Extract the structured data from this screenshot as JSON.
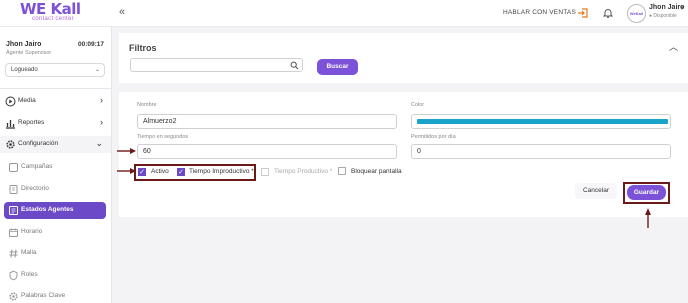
{
  "header": {
    "logo_main": "WE Kall",
    "logo_sub": "contact center",
    "collapse_glyph": "«",
    "hablar_label": "HABLAR CON VENTAS",
    "user_name": "Jhon Jairo",
    "user_status": "● Disponible",
    "avatar_text": "WeKall"
  },
  "agent": {
    "name": "Jhon Jairo",
    "time": "00:09:17",
    "role": "Agente Supervisor",
    "status_value": "Logueado"
  },
  "sidebar": {
    "items": [
      {
        "label": "Media",
        "icon": "play-circle-icon"
      },
      {
        "label": "Reportes",
        "icon": "chart-icon"
      },
      {
        "label": "Configuración",
        "icon": "gear-icon"
      },
      {
        "label": "Campañas",
        "icon": "campaign-icon"
      },
      {
        "label": "Directorio",
        "icon": "directory-icon"
      },
      {
        "label": "Estados Agentes",
        "icon": "agent-status-icon"
      },
      {
        "label": "Horario",
        "icon": "calendar-icon"
      },
      {
        "label": "Malla",
        "icon": "hash-icon"
      },
      {
        "label": "Roles",
        "icon": "shield-icon"
      },
      {
        "label": "Palabras Clave",
        "icon": "gear-icon"
      }
    ]
  },
  "filters": {
    "title": "Filtros",
    "search_value": "",
    "search_button": "Buscar"
  },
  "form": {
    "nombre_label": "Nombre",
    "nombre_value": "Almuerzo2",
    "color_label": "Color",
    "color_value": "#1aa3c8",
    "tiempo_label": "Tiempo en segundos",
    "tiempo_value": "60",
    "permitidos_label": "Permitidos por día",
    "permitidos_value": "0",
    "checkboxes": [
      {
        "label": "Activo",
        "checked": true
      },
      {
        "label": "Tiempo Improductivo *",
        "checked": true
      },
      {
        "label": "Tiempo Productivo *",
        "checked": false
      },
      {
        "label": "Bloquear pantalla",
        "checked": false
      }
    ],
    "cancel_label": "Cancelar",
    "save_label": "Guardar"
  },
  "colors": {
    "accent": "#7b52d8",
    "active_nav": "#6c49c7",
    "annotation": "#6b1a1a"
  }
}
